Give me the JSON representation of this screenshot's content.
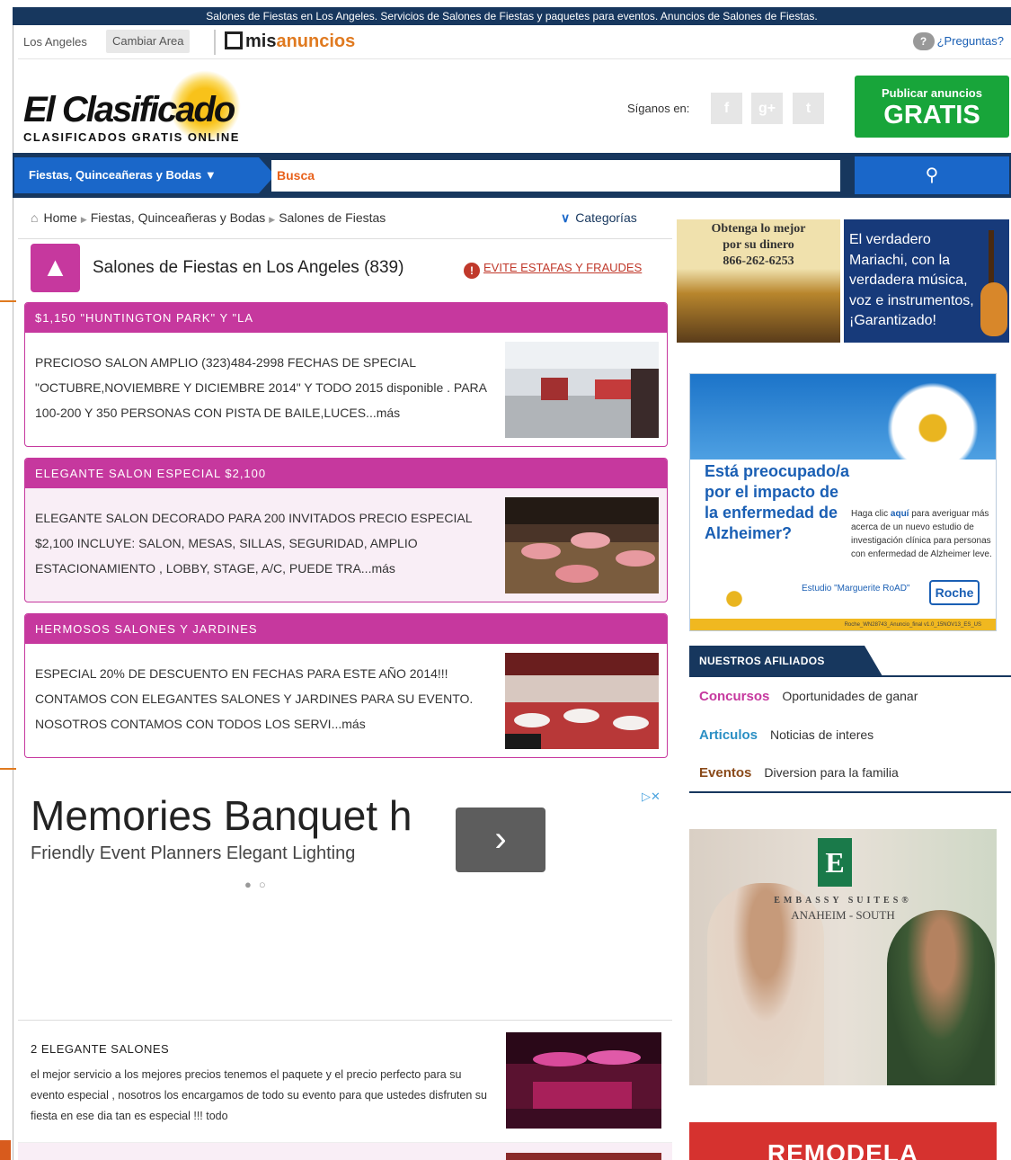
{
  "topbar": {
    "text": "Salones de Fiestas en Los Angeles. Servicios de Salones de Fiestas y paquetes para eventos. Anuncios de Salones de Fiestas."
  },
  "header": {
    "city": "Los Angeles",
    "change_area": "Cambiar Area",
    "misanuncios_a": "mis",
    "misanuncios_b": "anuncios",
    "questions": "¿Preguntas?"
  },
  "logo": {
    "name": "El Clasificado",
    "tagline": "CLASIFICADOS GRATIS ONLINE"
  },
  "social": {
    "label": "Síganos en:",
    "icons": [
      "facebook-icon",
      "google-plus-icon",
      "twitter-icon"
    ]
  },
  "publish": {
    "line1": "Publicar anuncios",
    "line2": "GRATIS"
  },
  "nav": {
    "category": "Fiestas, Quinceañeras y Bodas",
    "search_value": "Busca"
  },
  "breadcrumb": {
    "home": "Home",
    "level1": "Fiestas, Quinceañeras y Bodas",
    "current": "Salones de Fiestas"
  },
  "categories_label": "Categorías",
  "list_title": "Salones de Fiestas en Los Angeles (839)",
  "warning_link": "EVITE ESTAFAS Y FRAUDES",
  "listings": [
    {
      "title": "$1,150 \"HUNTINGTON PARK\" Y \"LA",
      "text": "PRECIOSO SALON AMPLIO (323)484-2998 FECHAS DE SPECIAL \"OCTUBRE,NOVIEMBRE Y DICIEMBRE 2014\" Y TODO 2015 disponible . PARA 100-200 Y 350 PERSONAS CON PISTA DE BAILE,LUCES...más"
    },
    {
      "title": "ELEGANTE SALON ESPECIAL $2,100",
      "text": "ELEGANTE SALON DECORADO PARA 200 INVITADOS PRECIO ESPECIAL $2,100 INCLUYE: SALON, MESAS, SILLAS, SEGURIDAD, AMPLIO ESTACIONAMIENTO , LOBBY, STAGE, A/C, PUEDE TRA...más"
    },
    {
      "title": "HERMOSOS SALONES Y JARDINES",
      "text": "ESPECIAL 20% DE DESCUENTO EN FECHAS PARA ESTE AÑO 2014!!! CONTAMOS CON ELEGANTES SALONES Y JARDINES PARA SU EVENTO. NOSOTROS CONTAMOS CON TODOS LOS SERVI...más"
    }
  ],
  "ad": {
    "title": "Memories Banquet h",
    "subtitle": "Friendly Event Planners Elegant Lighting"
  },
  "listing4": {
    "title": "2 ELEGANTE SALONES",
    "text": "el mejor servicio a los mejores precios tenemos el paquete y el precio perfecto para su evento especial , nosotros los encargamos de todo su evento para que ustedes disfruten su fiesta en ese dia tan es especial !!! todo"
  },
  "banner1": {
    "line1": "Obtenga lo mejor",
    "line2": "por su dinero",
    "phone": "866-262-6253"
  },
  "banner2": {
    "text": "El verdadero Mariachi, con la verdadera música, voz e instrumentos, ¡Garantizado!"
  },
  "banner3": {
    "headline": "Está preocupado/a por el impacto de la enfermedad de Alzheimer?",
    "body_a": "Haga clic ",
    "body_link": "aquí",
    "body_b": " para averiguar más acerca de un nuevo estudio de investigación clínica para personas con enfermedad de Alzheimer leve.",
    "study": "Estudio \"Marguerite RoAD\"",
    "brand": "Roche",
    "footer": "Roche_WN28743_Anuncio_final v1.0_15NOV13_ES_US"
  },
  "affiliates": {
    "header": "NUESTROS AFILIADOS",
    "items": [
      {
        "key": "Concursos",
        "desc": "Oportunidades de ganar",
        "color": "#c6389e"
      },
      {
        "key": "Articulos",
        "desc": "Noticias de interes",
        "color": "#2b8fc4"
      },
      {
        "key": "Eventos",
        "desc": "Diversion para la familia",
        "color": "#8a4a1a"
      }
    ]
  },
  "banner4": {
    "brand": "EMBASSY SUITES®",
    "location": "ANAHEIM - SOUTH"
  },
  "banner5": {
    "text": "REMODELA"
  }
}
